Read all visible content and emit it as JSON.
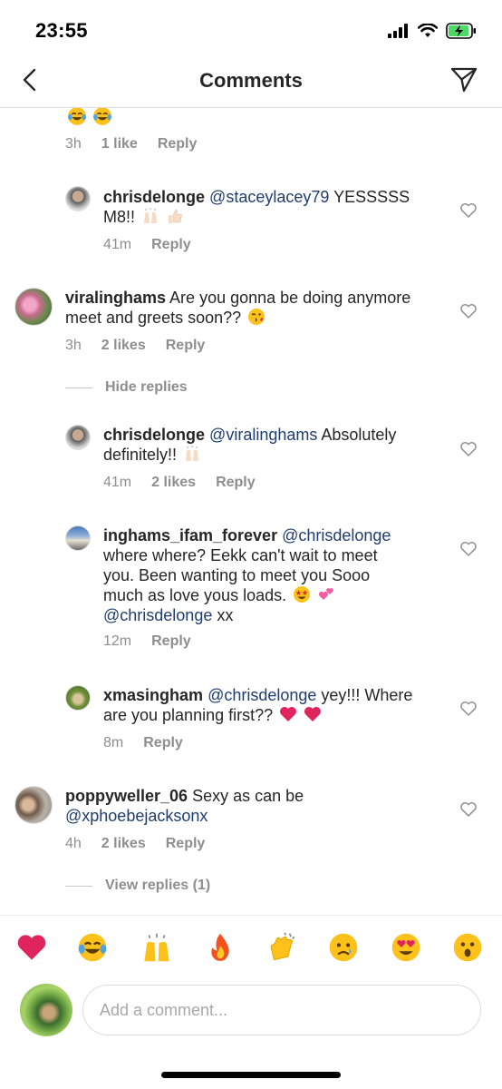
{
  "status_bar": {
    "time": "23:55"
  },
  "nav": {
    "title": "Comments"
  },
  "comments": [
    {
      "meta": {
        "time": "3h",
        "likes": "1 like",
        "reply": "Reply"
      }
    },
    {
      "user": "chrisdelonge",
      "mention": "@staceylacey79",
      "text": " YESSSSS M8!!",
      "meta": {
        "time": "41m",
        "reply": "Reply"
      }
    },
    {
      "user": "viralinghams",
      "text": " Are you gonna be doing anymore meet and greets soon??",
      "meta": {
        "time": "3h",
        "likes": "2 likes",
        "reply": "Reply"
      },
      "toggle": "Hide replies"
    },
    {
      "user": "chrisdelonge",
      "mention": "@viralinghams",
      "text": " Absolutely definitely!!",
      "meta": {
        "time": "41m",
        "likes": "2 likes",
        "reply": "Reply"
      }
    },
    {
      "user": "inghams_ifam_forever",
      "mention": "@chrisdelonge",
      "text": " where where? Eekk can't wait to meet you. Been wanting to meet you Sooo much as love yous loads.",
      "mention2": "@chrisdelonge",
      "text2": " xx",
      "meta": {
        "time": "12m",
        "reply": "Reply"
      }
    },
    {
      "user": "xmasingham",
      "mention": "@chrisdelonge",
      "text": " yey!!! Where are you planning first??",
      "meta": {
        "time": "8m",
        "reply": "Reply"
      }
    },
    {
      "user": "poppyweller_06",
      "text": " Sexy as can be",
      "mention": "@xphoebejacksonx",
      "meta": {
        "time": "4h",
        "likes": "2 likes",
        "reply": "Reply"
      },
      "toggle": "View replies (1)"
    }
  ],
  "reactions": [
    "red-heart",
    "tears-of-joy",
    "raised-hands",
    "fire",
    "clapping-hands",
    "crying-face",
    "heart-eyes",
    "astonished-face"
  ],
  "compose": {
    "placeholder": "Add a comment..."
  },
  "colors": {
    "mention": "#1f3d6e",
    "meta": "#8e8e8e",
    "text": "#262626"
  }
}
